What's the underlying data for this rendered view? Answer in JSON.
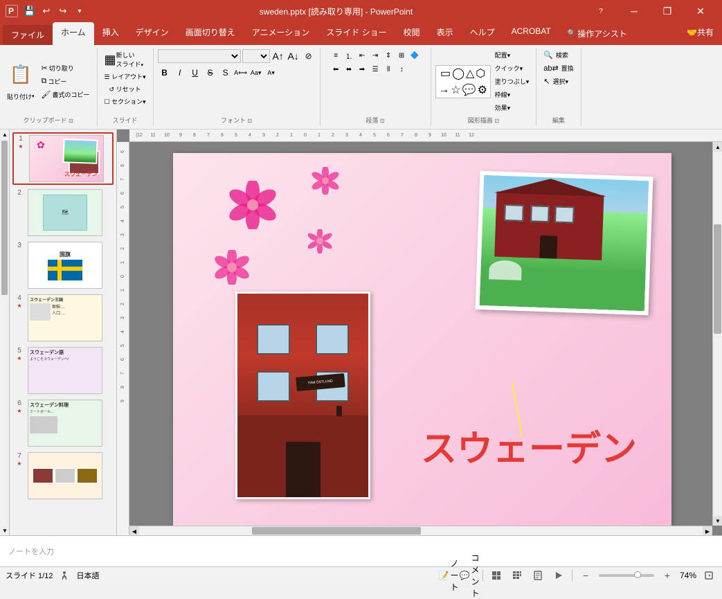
{
  "titlebar": {
    "title": "sweden.pptx [読み取り専用]  -  PowerPoint",
    "minimize": "─",
    "restore": "❐",
    "close": "✕",
    "app_icon": "P"
  },
  "ribbon": {
    "tabs": [
      "ファイル",
      "ホーム",
      "挿入",
      "デザイン",
      "画面切り替え",
      "アニメーション",
      "スライド ショー",
      "校閲",
      "表示",
      "ヘルプ",
      "ACROBAT",
      "操作アシスト",
      "共有"
    ],
    "active_tab": "ホーム",
    "groups": {
      "clipboard": {
        "label": "クリップボード",
        "paste": "貼り付け",
        "cut": "✂",
        "copy": "⧉",
        "format": "🖌"
      },
      "slide": {
        "label": "スライド",
        "new": "新しいスライド",
        "layout": "レイアウト▼",
        "reset": "リセット",
        "section": "セクション▼"
      },
      "font": {
        "label": "フォント",
        "face": "",
        "size": "",
        "bold": "B",
        "italic": "I",
        "underline": "U",
        "strikethrough": "S",
        "shadow": "S",
        "spacing": "A",
        "case": "Aa"
      },
      "paragraph": {
        "label": "段落"
      },
      "drawing": {
        "label": "図形描画"
      },
      "arrange": {
        "label": "配置"
      },
      "quickstyle": {
        "label": "クイックスタイル▼"
      },
      "editing": {
        "label": "編集",
        "find": "検索",
        "replace": "置換",
        "select": "選択"
      }
    }
  },
  "slides": [
    {
      "num": "1",
      "starred": true,
      "active": true
    },
    {
      "num": "2",
      "starred": false
    },
    {
      "num": "3",
      "starred": false
    },
    {
      "num": "4",
      "starred": true
    },
    {
      "num": "5",
      "starred": true
    },
    {
      "num": "6",
      "starred": true
    },
    {
      "num": "7",
      "starred": true
    }
  ],
  "canvas": {
    "slide_title": "スウェーデン",
    "notes_placeholder": "ノートを入力"
  },
  "statusbar": {
    "slide_info": "スライド 1/12",
    "language": "日本語",
    "notes": "ノート",
    "comment": "コメント",
    "zoom": "74%",
    "zoom_level": 74
  },
  "icons": {
    "save": "💾",
    "undo": "↩",
    "redo": "↪",
    "more": "▾",
    "paste_icon": "📋",
    "new_slide": "▦",
    "search": "🔍",
    "replace": "ab↔",
    "select_arrow": "↖",
    "normal_view": "▣",
    "slide_sorter": "⊞",
    "reading_view": "📖",
    "slideshow": "▶",
    "notes_icon": "📝",
    "comment_icon": "💬",
    "fit": "⊡",
    "zoom_out": "−",
    "zoom_in": "+"
  }
}
